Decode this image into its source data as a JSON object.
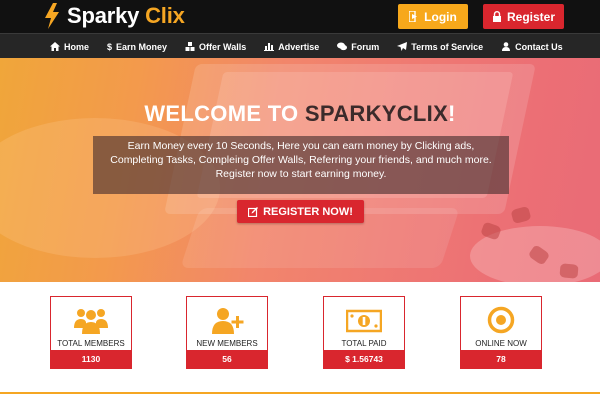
{
  "header": {
    "logo_word1": "Sparky",
    "logo_word2": "Clix",
    "login_label": "Login",
    "register_label": "Register"
  },
  "nav": {
    "items": [
      {
        "label": "Home",
        "icon": "home-icon"
      },
      {
        "label": "Earn Money",
        "icon": "dollar-icon"
      },
      {
        "label": "Offer Walls",
        "icon": "cubes-icon"
      },
      {
        "label": "Advertise",
        "icon": "bar-chart-icon"
      },
      {
        "label": "Forum",
        "icon": "comments-icon"
      },
      {
        "label": "Terms of Service",
        "icon": "paper-plane-icon"
      },
      {
        "label": "Contact Us",
        "icon": "user-icon"
      }
    ]
  },
  "hero": {
    "welcome_prefix": "WELCOME TO ",
    "welcome_brand": "SPARKYCLIX",
    "welcome_suffix": "!",
    "description": "Earn Money every 10 Seconds, Here you can earn money by Clicking ads, Completing Tasks, Compleing Offer Walls, Referring your friends, and much more. Register now to start earning money.",
    "cta_label": "REGISTER NOW!"
  },
  "stats": [
    {
      "label": "TOTAL MEMBERS",
      "value": "1130",
      "icon": "users-icon"
    },
    {
      "label": "NEW MEMBERS",
      "value": "56",
      "icon": "user-plus-icon"
    },
    {
      "label": "TOTAL PAID",
      "value": "$ 1.56743",
      "icon": "money-icon"
    },
    {
      "label": "ONLINE NOW",
      "value": "78",
      "icon": "dot-circle-icon"
    }
  ],
  "colors": {
    "brand_orange": "#f5a623",
    "brand_red": "#d9262e",
    "header_bg": "#111111",
    "nav_bg": "#262626"
  }
}
